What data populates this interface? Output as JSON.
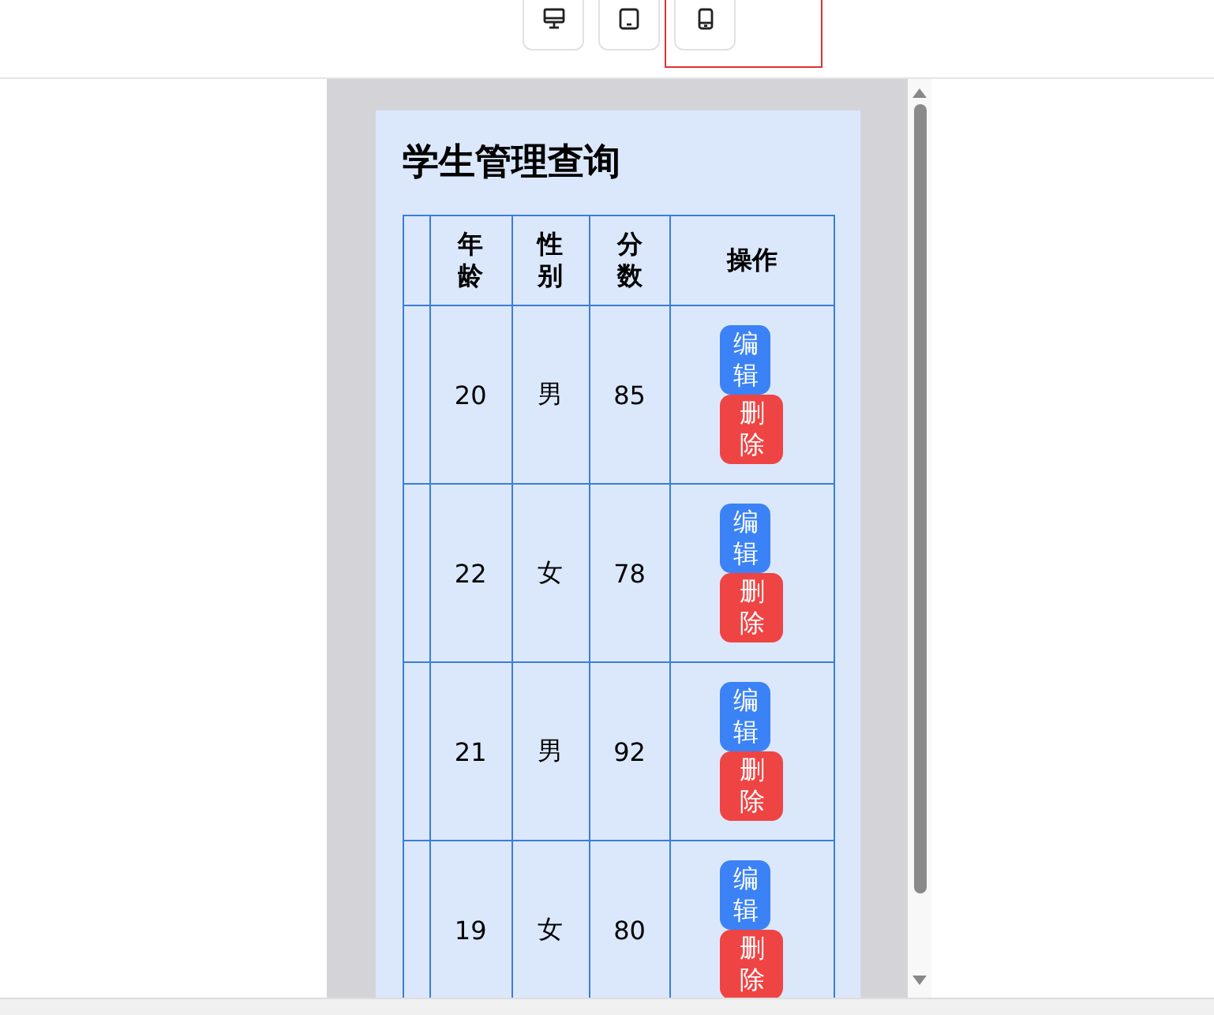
{
  "device_buttons": [
    {
      "kind": "desktop",
      "selected": false
    },
    {
      "kind": "tablet",
      "selected": false
    },
    {
      "kind": "mobile",
      "selected": true
    }
  ],
  "title": "学生管理查询",
  "table": {
    "columns": [
      "年龄",
      "性别",
      "分数",
      "操作"
    ],
    "rows": [
      {
        "cells": [
          "20",
          "男",
          "85"
        ],
        "actions": [
          "编辑",
          "删除"
        ]
      },
      {
        "cells": [
          "22",
          "女",
          "78"
        ],
        "actions": [
          "编辑",
          "删除"
        ]
      },
      {
        "cells": [
          "21",
          "男",
          "92"
        ],
        "actions": [
          "编辑",
          "删除"
        ]
      },
      {
        "cells": [
          "19",
          "女",
          "80"
        ],
        "actions": [
          "编辑",
          "删除"
        ]
      }
    ]
  }
}
